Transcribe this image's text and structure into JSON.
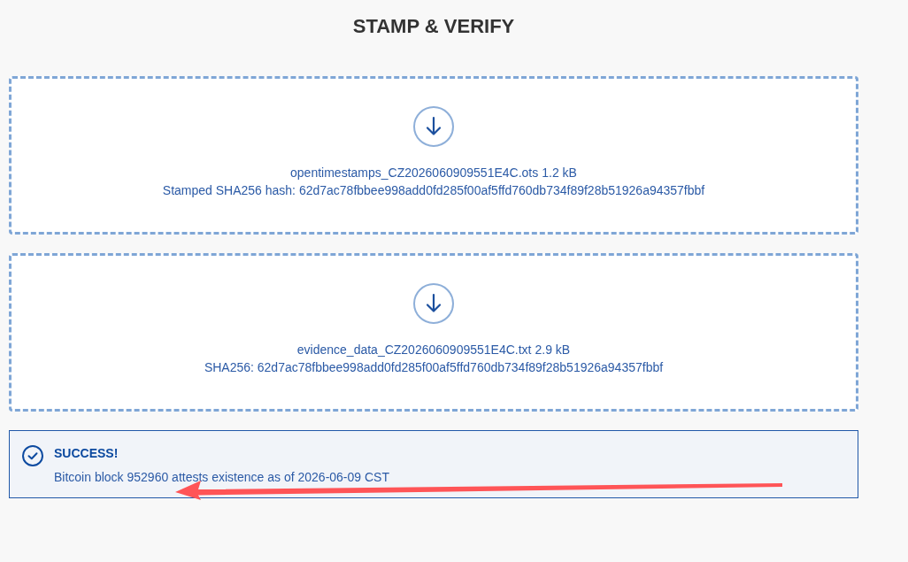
{
  "title": "STAMP & VERIFY",
  "files": [
    {
      "kind": "download",
      "name": "opentimestamps_CZ2026060909551E4C.ots",
      "size": "1.2 kB",
      "hash_line": "Stamped SHA256 hash: 62d7ac78fbbee998add0fd285f00af5ffd760db734f89f28b51926a94357fbbf"
    },
    {
      "kind": "download",
      "name": "evidence_data_CZ2026060909551E4C.txt",
      "size": "2.9 kB",
      "hash_line": "SHA256: 62d7ac78fbbee998add0fd285f00af5ffd760db734f89f28b51926a94357fbbf"
    }
  ],
  "status": {
    "kind": "success",
    "title": "SUCCESS!",
    "message": "Bitcoin block 952960 attests existence as of 2026-06-09 CST"
  },
  "annotation": {
    "kind": "arrow"
  }
}
